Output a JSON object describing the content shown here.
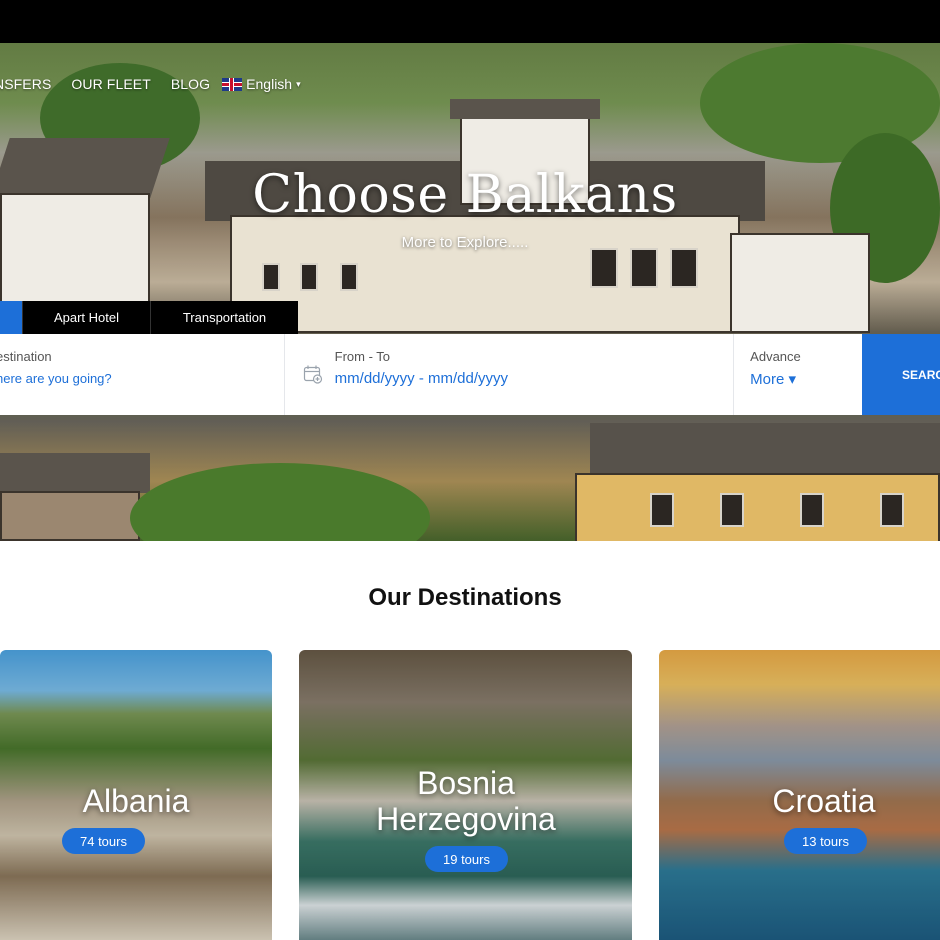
{
  "nav": {
    "links": [
      "NSFERS",
      "OUR FLEET",
      "BLOG"
    ],
    "language": "English",
    "language_caret": "▾"
  },
  "hero": {
    "title": "Choose Balkans",
    "subtitle": "More to Explore....."
  },
  "tabs": [
    "Apart Hotel",
    "Transportation"
  ],
  "search": {
    "destination_label": "estination",
    "destination_placeholder": "here are you going?",
    "dates_label": "From - To",
    "dates_value": "mm/dd/yyyy - mm/dd/yyyy",
    "advance_label": "Advance",
    "advance_value": "More ▾",
    "button_label": "SEARCH"
  },
  "destinations": {
    "title": "Our Destinations",
    "cards": [
      {
        "name": "Albania",
        "tours": "74 tours"
      },
      {
        "name": "Bosnia Herzegovina",
        "tours": "19 tours"
      },
      {
        "name": "Croatia",
        "tours": "13 tours"
      }
    ]
  },
  "colors": {
    "accent": "#1d6fd8",
    "dark_tab": "#000000",
    "topbar": "#000000"
  }
}
